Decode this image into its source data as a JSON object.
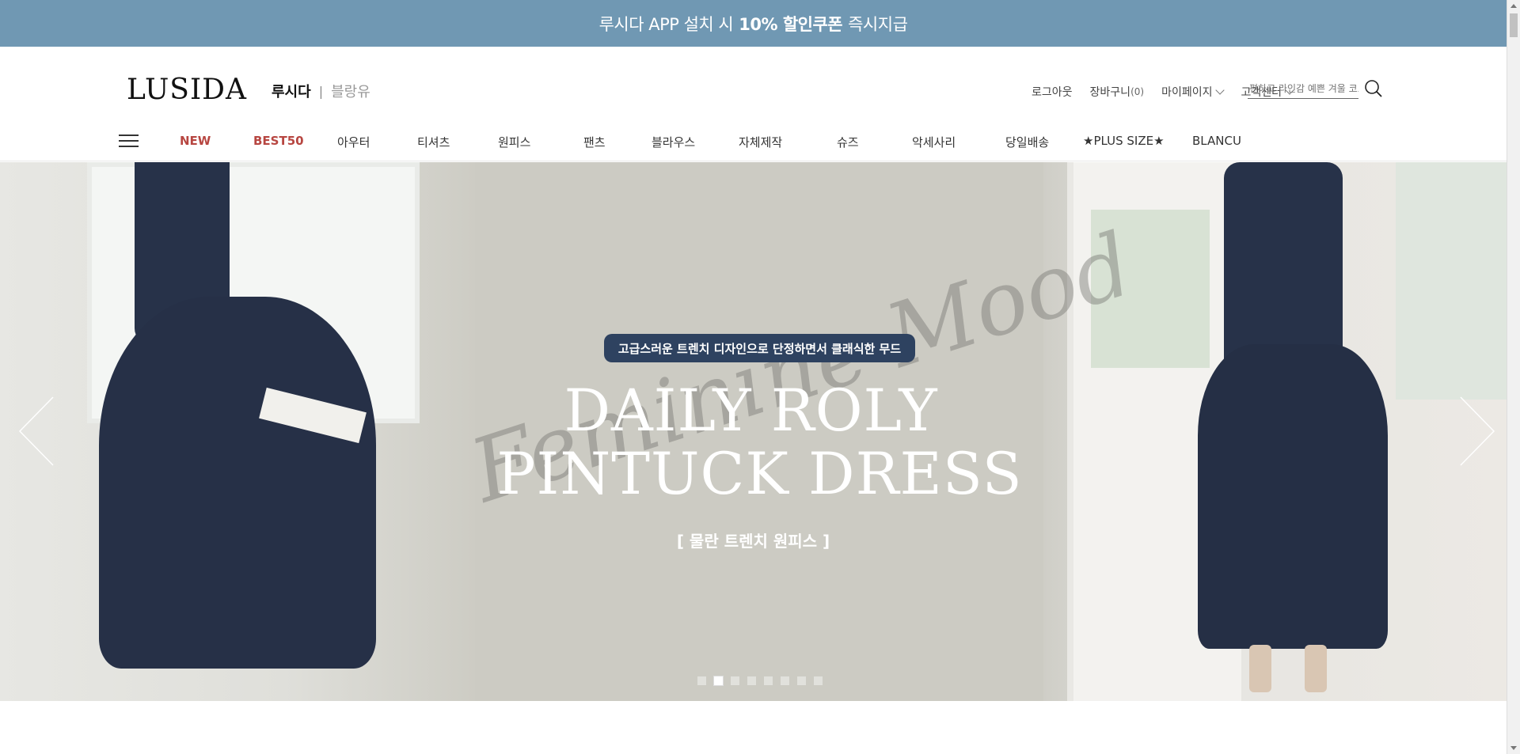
{
  "promo": {
    "before": "루시다 APP 설치 시",
    "bold": "10% 할인쿠폰",
    "after": "즉시지급",
    "color": "#7098b3"
  },
  "header": {
    "logo": "LUSIDA",
    "brand_active": "루시다",
    "brand_sep": "|",
    "brand_inactive": "블랑유",
    "util": {
      "logout": "로그아웃",
      "cart_label": "장바구니",
      "cart_count": "(0)",
      "mypage": "마이페이지",
      "customer_center": "고객센터"
    },
    "search": {
      "placeholder": "편하고 라인감 예쁜 겨울 코트",
      "icon": "search-icon"
    }
  },
  "nav": {
    "items": [
      {
        "label": "NEW",
        "highlight": true
      },
      {
        "label": "BEST50",
        "highlight": true
      },
      {
        "label": "아우터"
      },
      {
        "label": "티셔츠"
      },
      {
        "label": "원피스"
      },
      {
        "label": "팬츠"
      },
      {
        "label": "블라우스"
      },
      {
        "label": "자체제작"
      },
      {
        "label": "슈즈"
      },
      {
        "label": "악세사리"
      },
      {
        "label": "당일배송"
      },
      {
        "label": "★PLUS SIZE★"
      },
      {
        "label": "BLANCU"
      }
    ],
    "highlight_color": "#b74641"
  },
  "hero": {
    "pill": "고급스러운 트렌치 디자인으로 단정하면서 클래식한 무드",
    "script": "Feminine Mood",
    "title_line1": "DAILY ROLY",
    "title_line2": "PINTUCK DRESS",
    "subtitle": "[ 물란 트렌치 원피스 ]",
    "slide_count": 8,
    "active_slide": 2
  }
}
